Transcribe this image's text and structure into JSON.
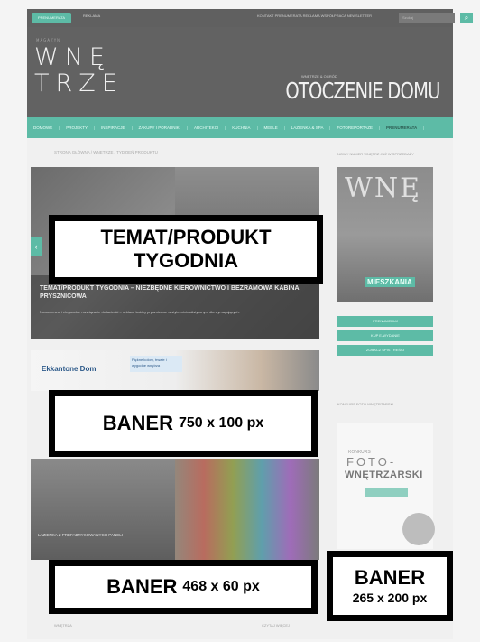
{
  "topbar": {
    "subscribe_label": "PRENUMERATA WNĘTRZ",
    "login_label": "REKLAMA",
    "links_label": "KONTAKT  PRENUMERATA  REKLAMA  WSPÓŁPRACA  NEWSLETTER",
    "search_placeholder": "Szukaj",
    "search_button": "⌕"
  },
  "header": {
    "logo_small": "MAGAZYN",
    "logo_line1": "WNĘ",
    "logo_line2": "TRZE",
    "brand_small": "WNĘTRZE & OGRÓD",
    "brand": "OTOCZENIE DOMU"
  },
  "nav": {
    "items": [
      "DOMOWE",
      "PROJEKTY",
      "INSPIRACJE",
      "ZAKUPY I PORADNIKI",
      "ARCHITEKCI",
      "KUCHNIA",
      "MEBLE",
      "LAZIENKA & SPA",
      "FOTOREPORTAŻE",
      "PRENUMERATA"
    ]
  },
  "content": {
    "breadcrumb": "STRONA GŁÓWNA / WNĘTRZE / TYDZIEŃ PRODUKTU",
    "hero_title": "TEMAT/PRODUKT TYGODNIA – NIEZBĘDNE KIEROWNICTWO I BEZRAMOWA KABINA PRYSZNICOWA",
    "hero_desc": "Nowoczesne i eleganckie rozwiązanie do łazienki – szklane kabiny prysznicowe w stylu minimalistycznym dla wymagających.",
    "banner_brand": "Ekkantone Dom",
    "banner_pill": "Piękne kolory, trwałe i wygodne wnętrza",
    "tile_caption": "ŁAZIENKA Z PREFABRYKOWANYCH PANELI",
    "footer_left": "WNĘTRZA",
    "footer_right": "CZYTAJ WIĘCEJ"
  },
  "sidebar": {
    "title": "NOWY NUMER WNĘTRZ JUŻ W SPRZEDAŻY",
    "cover_mag": "WNĘ",
    "cover_tag": "MIESZKANIA",
    "buttons": [
      "PRENUMERUJ",
      "KUP E-WYDANIE",
      "ZOBACZ SPIS TREŚCI"
    ],
    "title2": "KONKURS FOTO-WNĘTRZARSKI",
    "contest_k": "KONKURS",
    "contest_f": "FOTO-",
    "contest_w": "WNĘTRZARSKI"
  },
  "overlays": {
    "temat_line1": "TEMAT/PRODUKT",
    "temat_line2": "TYGODNIA",
    "baner750_word": "BANER",
    "baner750_size": "750 x 100 px",
    "baner468_word": "BANER",
    "baner468_size": "468 x 60 px",
    "baner265_word": "BANER",
    "baner265_size": "265 x 200 px"
  },
  "colors": {
    "accent": "#5dbba6",
    "header": "#626262",
    "overlay_border": "#000000"
  }
}
